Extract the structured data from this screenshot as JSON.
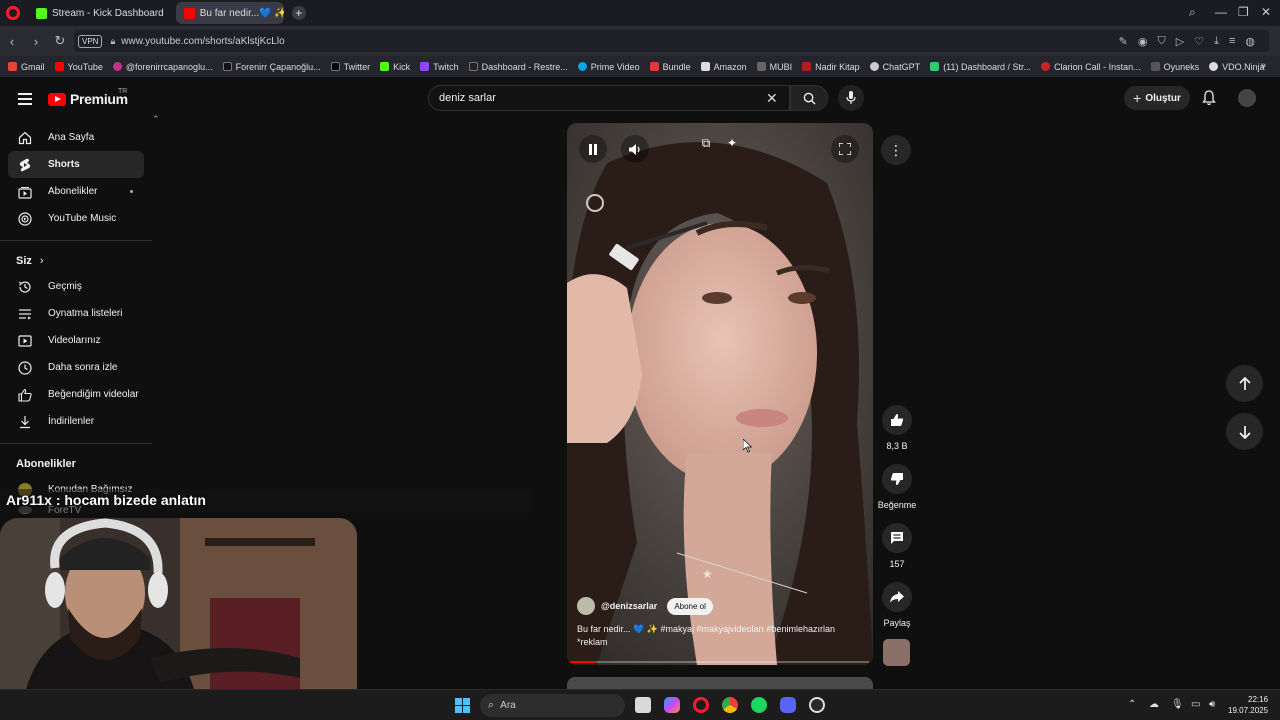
{
  "browser": {
    "tabs": [
      {
        "label": "Stream - Kick Dashboard"
      },
      {
        "label": "Bu far nedir...💙 ✨ #..."
      }
    ],
    "address": {
      "vpn": "VPN",
      "url": "www.youtube.com/shorts/aKlstjKcLlo"
    },
    "bookmarks": [
      "Gmail",
      "YouTube",
      "@forenirrcapanoglu...",
      "Forenirr Çapanoğlu...",
      "Twitter",
      "Kick",
      "Twitch",
      "Dashboard - Restre...",
      "Prime Video",
      "Bundle",
      "Amazon",
      "MUBI",
      "Nadir Kitap",
      "ChatGPT",
      "(11) Dashboard / Str...",
      "Clarion Call - Instan...",
      "Oyuneks",
      "VDO.Ninja"
    ]
  },
  "youtube": {
    "logo_text": "Premium",
    "region": "TR",
    "search_value": "deniz sarlar",
    "create_label": "Oluştur",
    "sidebar": {
      "main": [
        "Ana Sayfa",
        "Shorts",
        "Abonelikler",
        "YouTube Music"
      ],
      "you_header": "Siz",
      "you": [
        "Geçmiş",
        "Oynatma listeleri",
        "Videolarınız",
        "Daha sonra izle",
        "Beğendiğim videolar",
        "İndirilenler"
      ],
      "subs_header": "Abonelikler",
      "subs": [
        "Konudan Bağımsız",
        "ForeTV"
      ]
    },
    "short": {
      "channel": "@denizsarlar",
      "subscribe_label": "Abone ol",
      "description": "Bu far nedir... 💙 ✨ #makyaj #makyajvideoları #benimlehazırlan *reklam",
      "progress": 0.09,
      "likes": "8,3 B",
      "dislike_label": "Beğenme",
      "comments": "157",
      "share_label": "Paylaş"
    }
  },
  "overlay": {
    "chat_message": "Ar911x : hocam bizede anlatın"
  },
  "taskbar": {
    "search_placeholder": "Ara",
    "time": "22:16",
    "date": "19.07.2025"
  }
}
